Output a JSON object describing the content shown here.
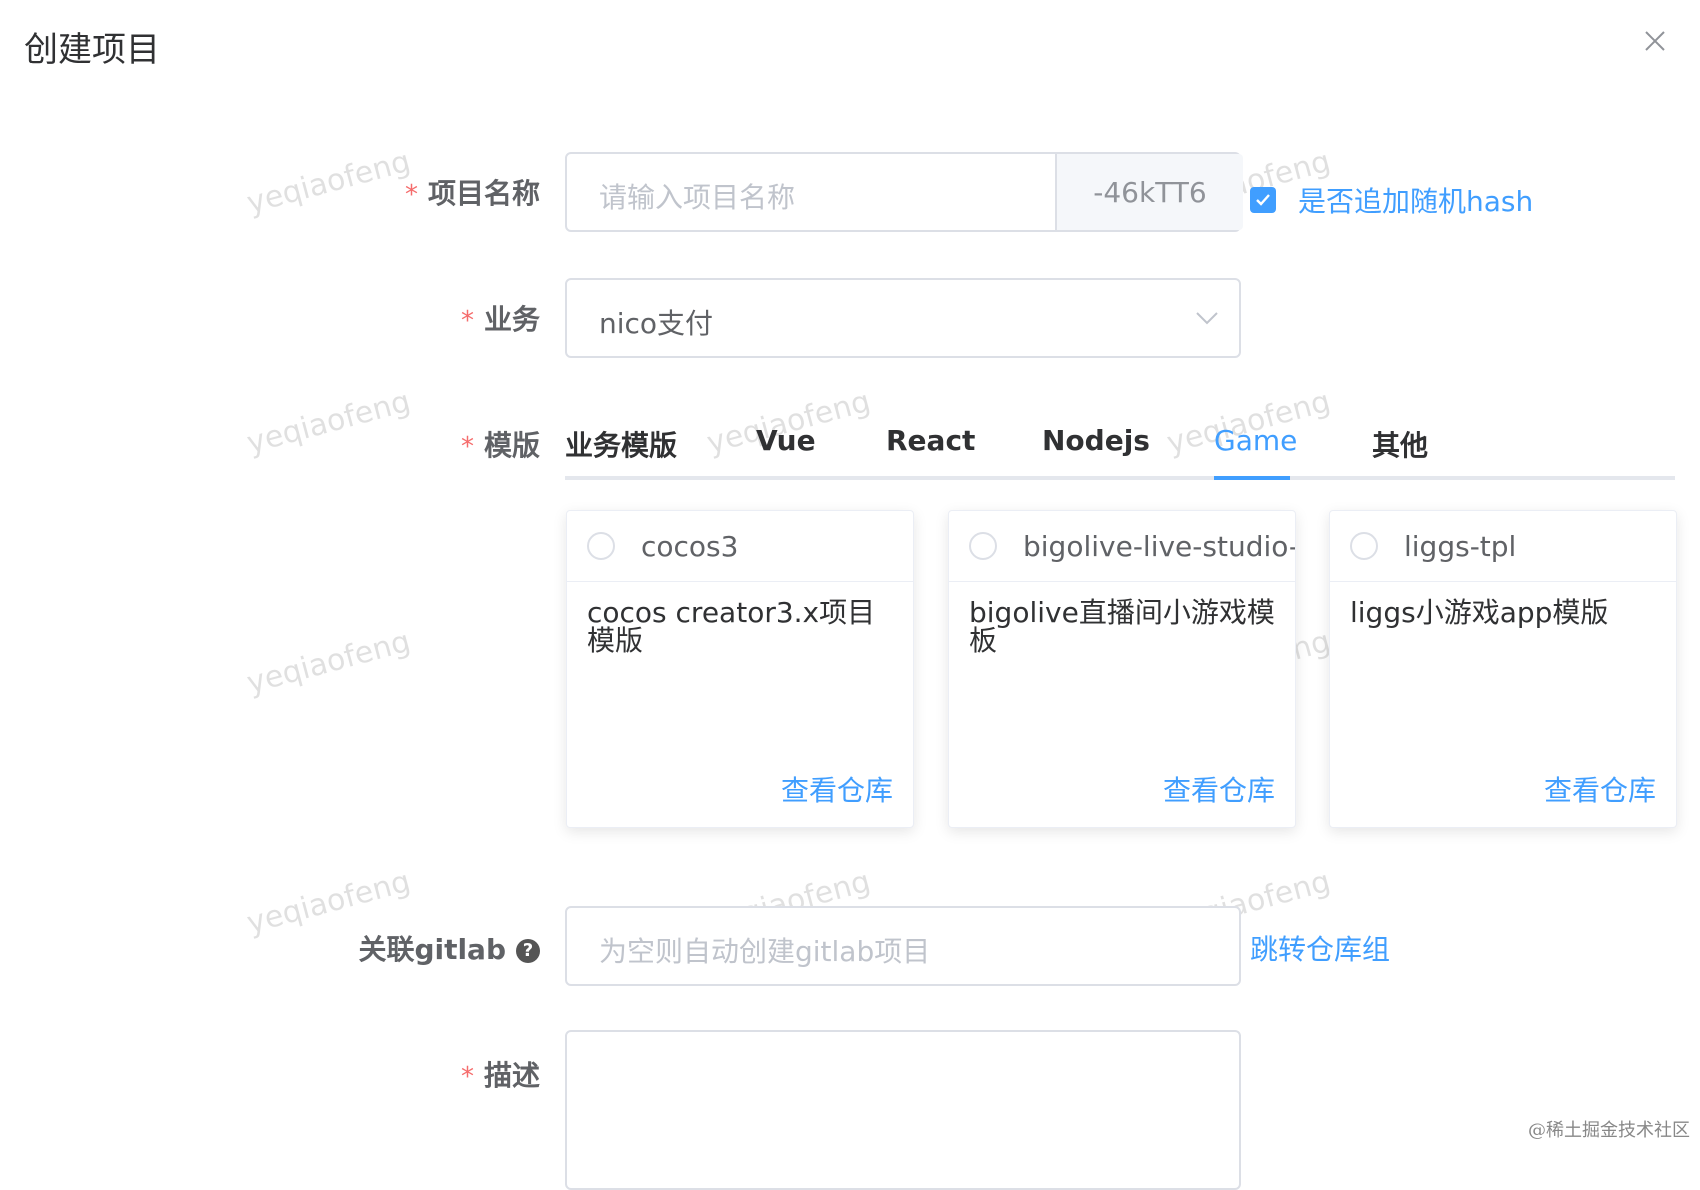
{
  "dialog": {
    "title": "创建项目",
    "close_icon": "close-icon"
  },
  "form": {
    "project_name": {
      "label": "项目名称",
      "placeholder": "请输入项目名称",
      "suffix": "-46kTT6",
      "hash_checkbox_label": "是否追加随机hash",
      "hash_checked": true
    },
    "business": {
      "label": "业务",
      "value": "nico支付"
    },
    "template": {
      "label": "模版",
      "tabs": [
        {
          "label": "业务模版",
          "active": false
        },
        {
          "label": "Vue",
          "active": false
        },
        {
          "label": "React",
          "active": false
        },
        {
          "label": "Nodejs",
          "active": false
        },
        {
          "label": "Game",
          "active": true
        },
        {
          "label": "其他",
          "active": false
        }
      ],
      "cards": [
        {
          "name": "cocos3",
          "desc": "cocos creator3.x项目模版",
          "link": "查看仓库"
        },
        {
          "name": "bigolive-live-studio-g",
          "desc": "bigolive直播间小游戏模板",
          "link": "查看仓库"
        },
        {
          "name": "liggs-tpl",
          "desc": "liggs小游戏app模版",
          "link": "查看仓库"
        }
      ]
    },
    "gitlab": {
      "label": "关联gitlab",
      "help_icon": "?",
      "placeholder": "为空则自动创建gitlab项目",
      "link": "跳转仓库组"
    },
    "description": {
      "label": "描述",
      "value": ""
    }
  },
  "watermark_text": "yeqiaofeng",
  "corner_mark": "@稀土掘金技术社区",
  "colors": {
    "primary": "#409eff",
    "required": "#f56c6c",
    "border": "#dcdfe6"
  }
}
